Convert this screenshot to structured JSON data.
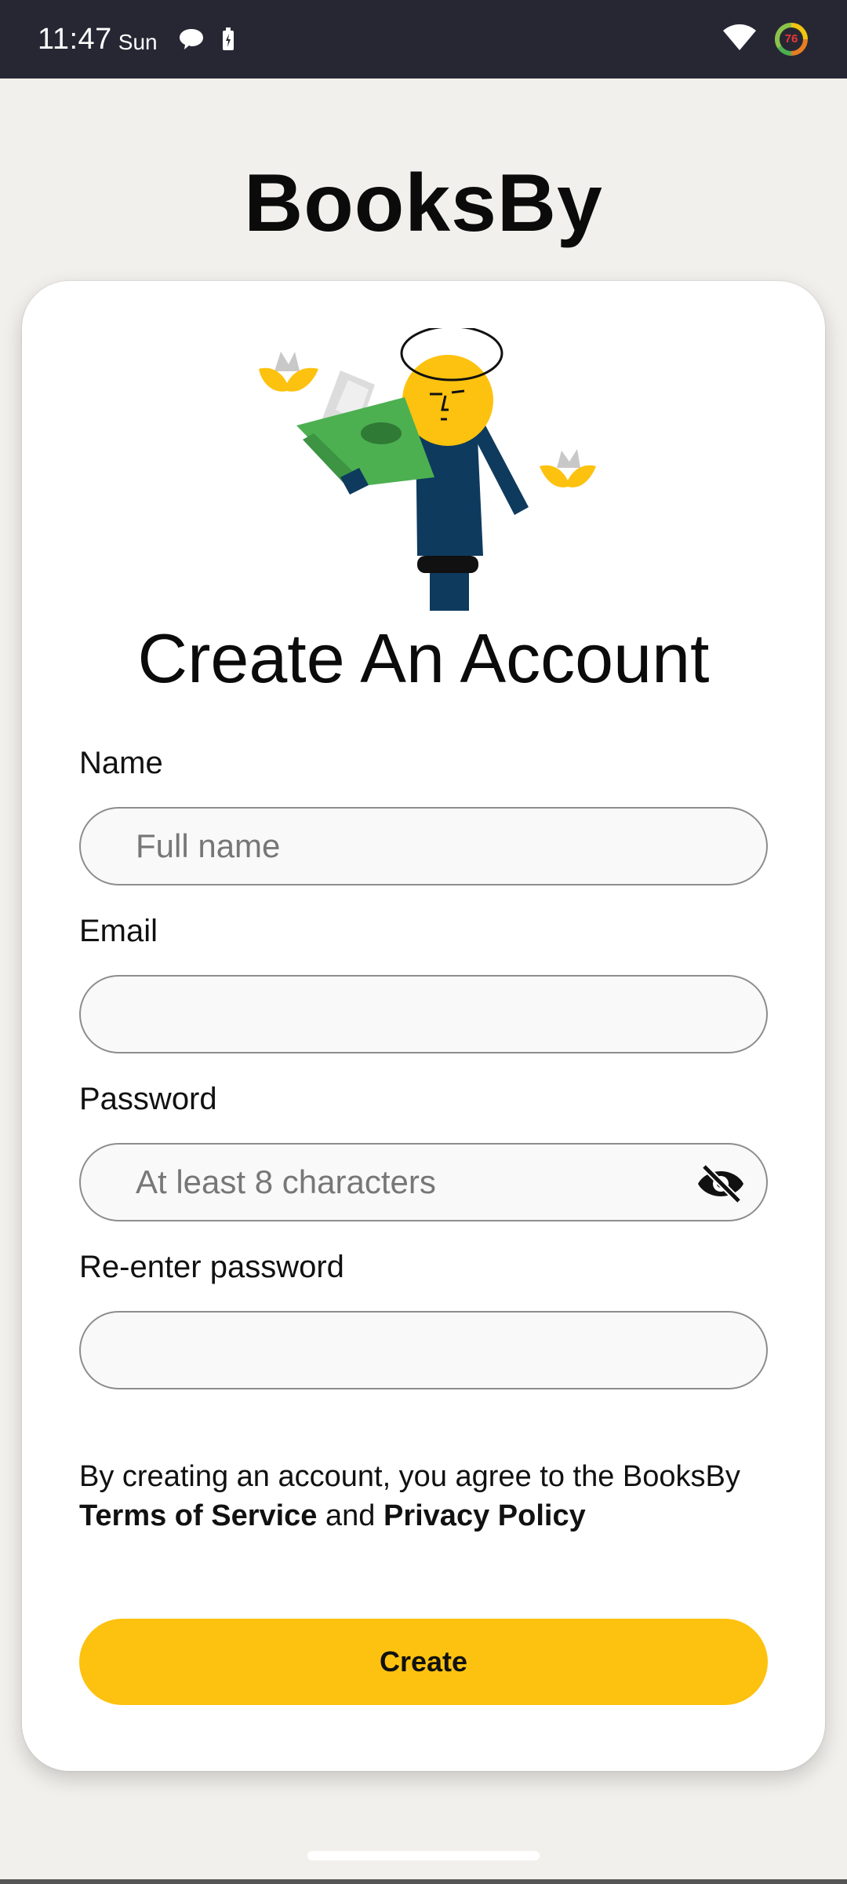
{
  "status_bar": {
    "time": "11:47",
    "day": "Sun",
    "battery_level": "76"
  },
  "app": {
    "title": "BooksBy"
  },
  "form": {
    "heading": "Create An Account",
    "name": {
      "label": "Name",
      "placeholder": "Full name",
      "value": ""
    },
    "email": {
      "label": "Email",
      "placeholder": "",
      "value": ""
    },
    "password": {
      "label": "Password",
      "placeholder": "At least 8 characters",
      "value": ""
    },
    "confirm_password": {
      "label": "Re-enter password",
      "placeholder": "",
      "value": ""
    },
    "terms": {
      "prefix": "By creating an account, you agree to the BooksBy",
      "terms_link": "Terms of Service",
      "conjunction": "and",
      "privacy_link": "Privacy Policy"
    },
    "submit_label": "Create"
  },
  "colors": {
    "accent": "#fdc20f",
    "background": "#f2f0ec",
    "status_bar": "#272734",
    "book_green": "#4cb050",
    "figure_navy": "#0e3a5e"
  },
  "icons": [
    "chat-bubble-icon",
    "battery-icon",
    "wifi-icon",
    "battery-ring-icon",
    "eye-off-icon"
  ]
}
